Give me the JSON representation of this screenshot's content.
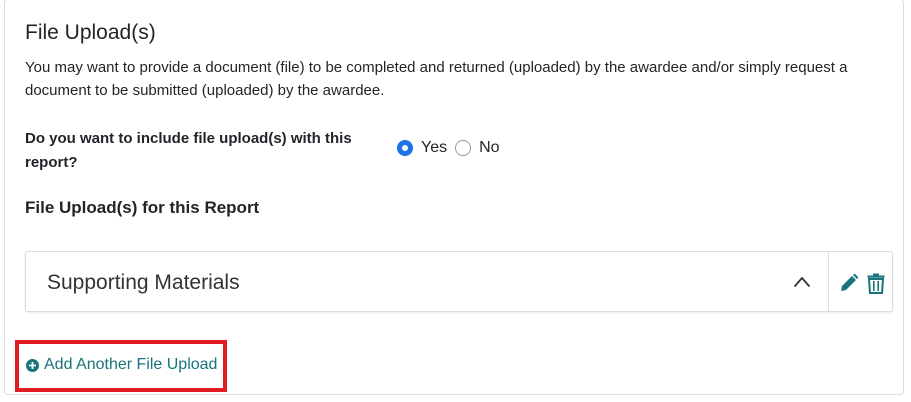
{
  "section": {
    "title": "File Upload(s)",
    "description": "You may want to provide a document (file) to be completed and returned (uploaded) by the awardee and/or simply request a document to be submitted (uploaded) by the awardee."
  },
  "question": {
    "label": "Do you want to include file upload(s) with this report?",
    "options": [
      {
        "label": "Yes",
        "selected": true
      },
      {
        "label": "No",
        "selected": false
      }
    ]
  },
  "uploads": {
    "heading": "File Upload(s) for this Report",
    "items": [
      {
        "title": "Supporting Materials",
        "expanded": true
      }
    ]
  },
  "actions": {
    "add_label": "Add Another File Upload"
  },
  "colors": {
    "accent": "#18737a",
    "radio": "#1a73e8",
    "highlight": "#e01b22"
  },
  "icons": [
    "chevron-up-icon",
    "pencil-icon",
    "trash-icon",
    "plus-circle-icon"
  ]
}
